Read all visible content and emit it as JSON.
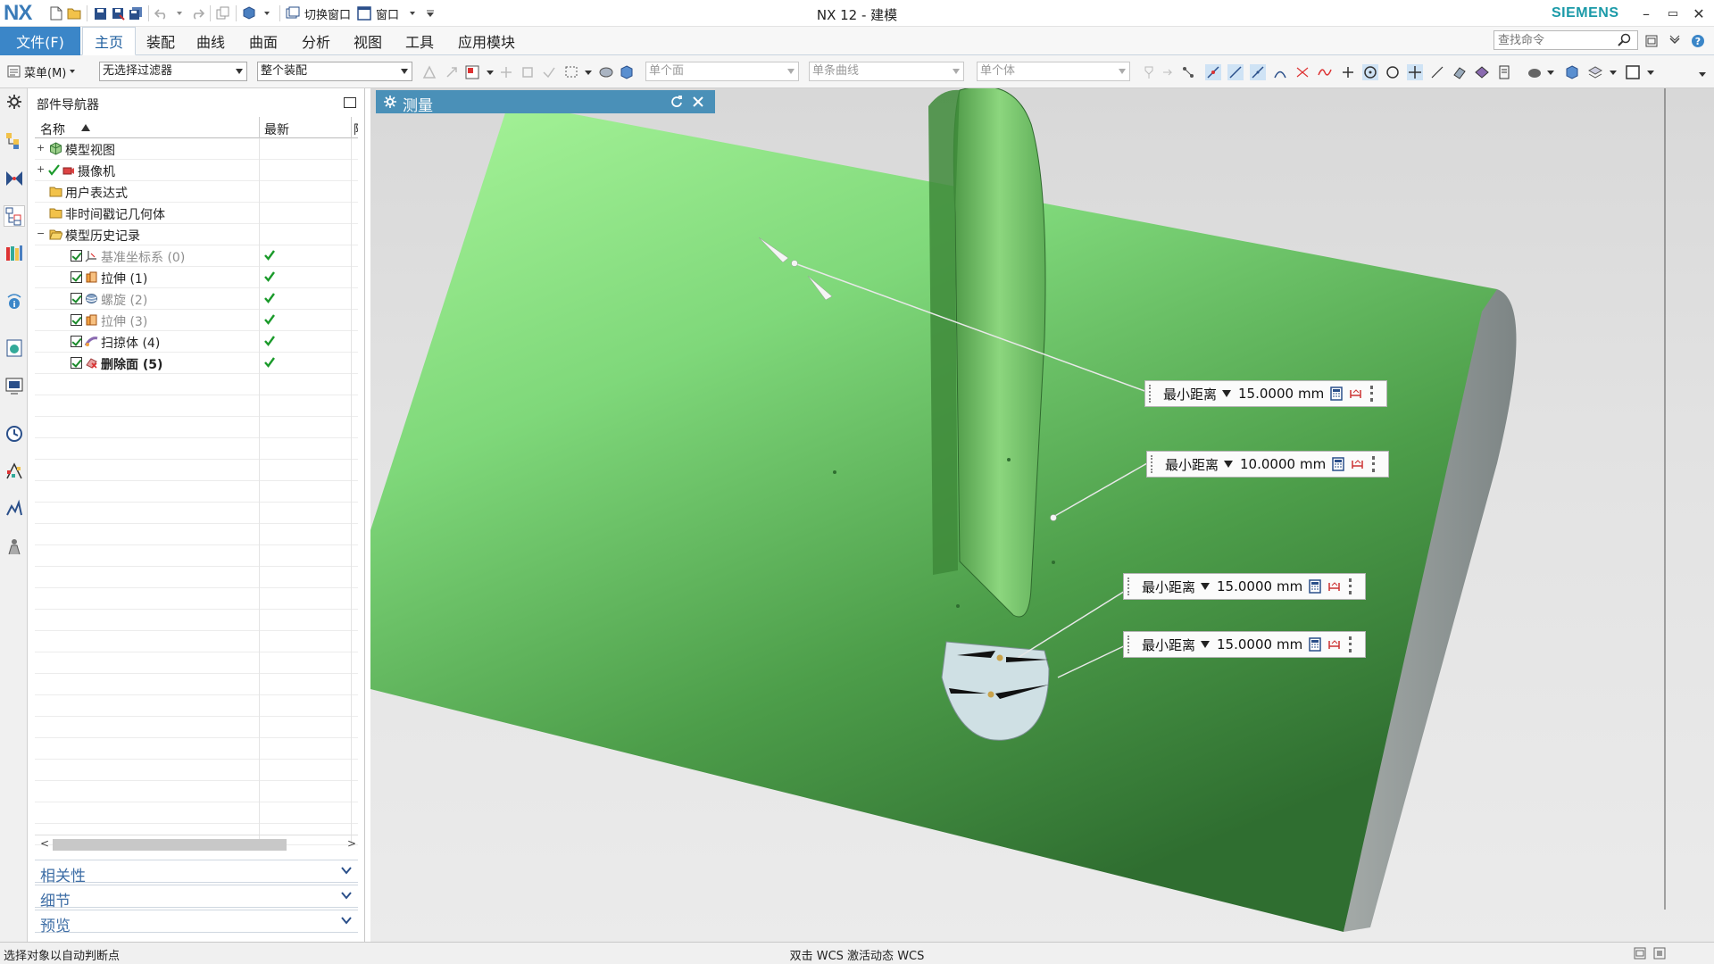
{
  "titlebar": {
    "logo": "NX",
    "switch_window": "切换窗口",
    "window_menu": "窗口",
    "title": "NX 12 - 建模",
    "brand": "SIEMENS",
    "minimize": "–",
    "restore": "▭",
    "close": "✕"
  },
  "ribbon": {
    "file_tab": "文件(F)",
    "tabs": [
      "主页",
      "装配",
      "曲线",
      "曲面",
      "分析",
      "视图",
      "工具",
      "应用模块"
    ],
    "active_tab": "主页",
    "search_placeholder": "查找命令"
  },
  "selection_toolbar": {
    "menu_label": "菜单(M)",
    "filter": "无选择过滤器",
    "scope": "整个装配",
    "face_rule": "单个面",
    "curve_rule": "单条曲线",
    "body_rule": "单个体"
  },
  "navigator": {
    "title": "部件导航器",
    "col_name": "名称",
    "col_latest": "最新",
    "col_extra": "附",
    "nodes": [
      {
        "label": "模型视图",
        "level": 0,
        "expander": "+",
        "icon": "model-views-icon"
      },
      {
        "label": "摄像机",
        "level": 0,
        "expander": "+",
        "icon": "camera-icon",
        "checked": true
      },
      {
        "label": "用户表达式",
        "level": 0,
        "expander": "",
        "icon": "folder-icon"
      },
      {
        "label": "非时间戳记几何体",
        "level": 0,
        "expander": "",
        "icon": "folder-icon"
      },
      {
        "label": "模型历史记录",
        "level": 0,
        "expander": "−",
        "icon": "folder-open-icon"
      },
      {
        "label": "基准坐标系 (0)",
        "level": 1,
        "icon": "datum-csys-icon",
        "disabled": true,
        "latest": true
      },
      {
        "label": "拉伸 (1)",
        "level": 1,
        "icon": "extrude-icon",
        "latest": true
      },
      {
        "label": "螺旋 (2)",
        "level": 1,
        "icon": "helix-icon",
        "disabled": true,
        "latest": true
      },
      {
        "label": "拉伸 (3)",
        "level": 1,
        "icon": "extrude-icon",
        "disabled": true,
        "latest": true
      },
      {
        "label": "扫掠体 (4)",
        "level": 1,
        "icon": "sweep-icon",
        "latest": true
      },
      {
        "label": "删除面 (5)",
        "level": 1,
        "icon": "delete-face-icon",
        "current": true,
        "latest": true
      }
    ],
    "sections": [
      "相关性",
      "细节",
      "预览"
    ]
  },
  "measure_dialog": {
    "title": "测量"
  },
  "dimensions": [
    {
      "type": "最小距离",
      "value": "15.0000",
      "unit": "mm"
    },
    {
      "type": "最小距离",
      "value": "10.0000",
      "unit": "mm"
    },
    {
      "type": "最小距离",
      "value": "15.0000",
      "unit": "mm"
    },
    {
      "type": "最小距离",
      "value": "15.0000",
      "unit": "mm"
    }
  ],
  "status": {
    "prompt": "选择对象以自动判断点",
    "center": "双击 WCS 激活动态 WCS"
  },
  "colors": {
    "accent": "#3b86c8",
    "brand": "#1a9aa8",
    "model_green": "#7fd87a",
    "measure_header": "#4a90b8",
    "check_green": "#1a9a2a"
  }
}
